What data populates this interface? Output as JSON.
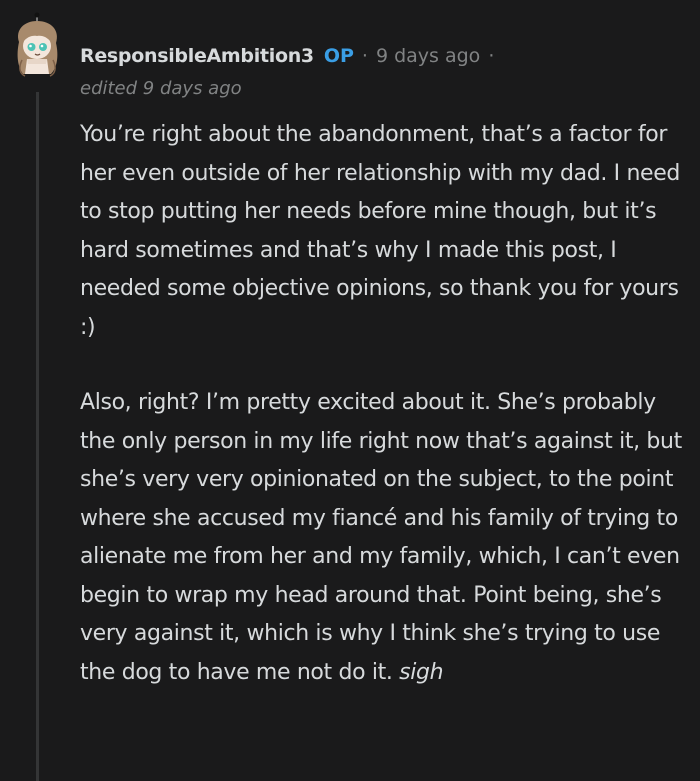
{
  "comment": {
    "username": "ResponsibleAmbition3",
    "op_badge": "OP",
    "separator": "·",
    "timestamp": "9 days ago",
    "edited": "edited 9 days ago",
    "paragraph_1": "You’re right about the abandonment, that’s a factor for her even outside of her relationship with my dad. I need to stop putting her needs before mine though, but it’s hard sometimes and that’s why I made this post, I needed some objective opinions, so thank you for yours :)",
    "paragraph_2": "Also, right? I’m pretty excited about it. She’s probably the only person in my life right now that’s against it, but she’s very very opinionated on the subject, to the point where she accused my fiancé and his family of trying to alienate me from her and my family, which, I can’t even begin to wrap my head around that. Point being, she’s very against it, which is why I think she’s trying to use the dog to have me not do it.",
    "paragraph_2_italic": "sigh"
  },
  "colors": {
    "background": "#1a1a1b",
    "text": "#d7dadc",
    "muted": "#818384",
    "op_blue": "#3a9ee5",
    "thread_line": "#343536"
  },
  "icons": {
    "avatar": "snoo-avatar-girl-teal-eyes"
  }
}
